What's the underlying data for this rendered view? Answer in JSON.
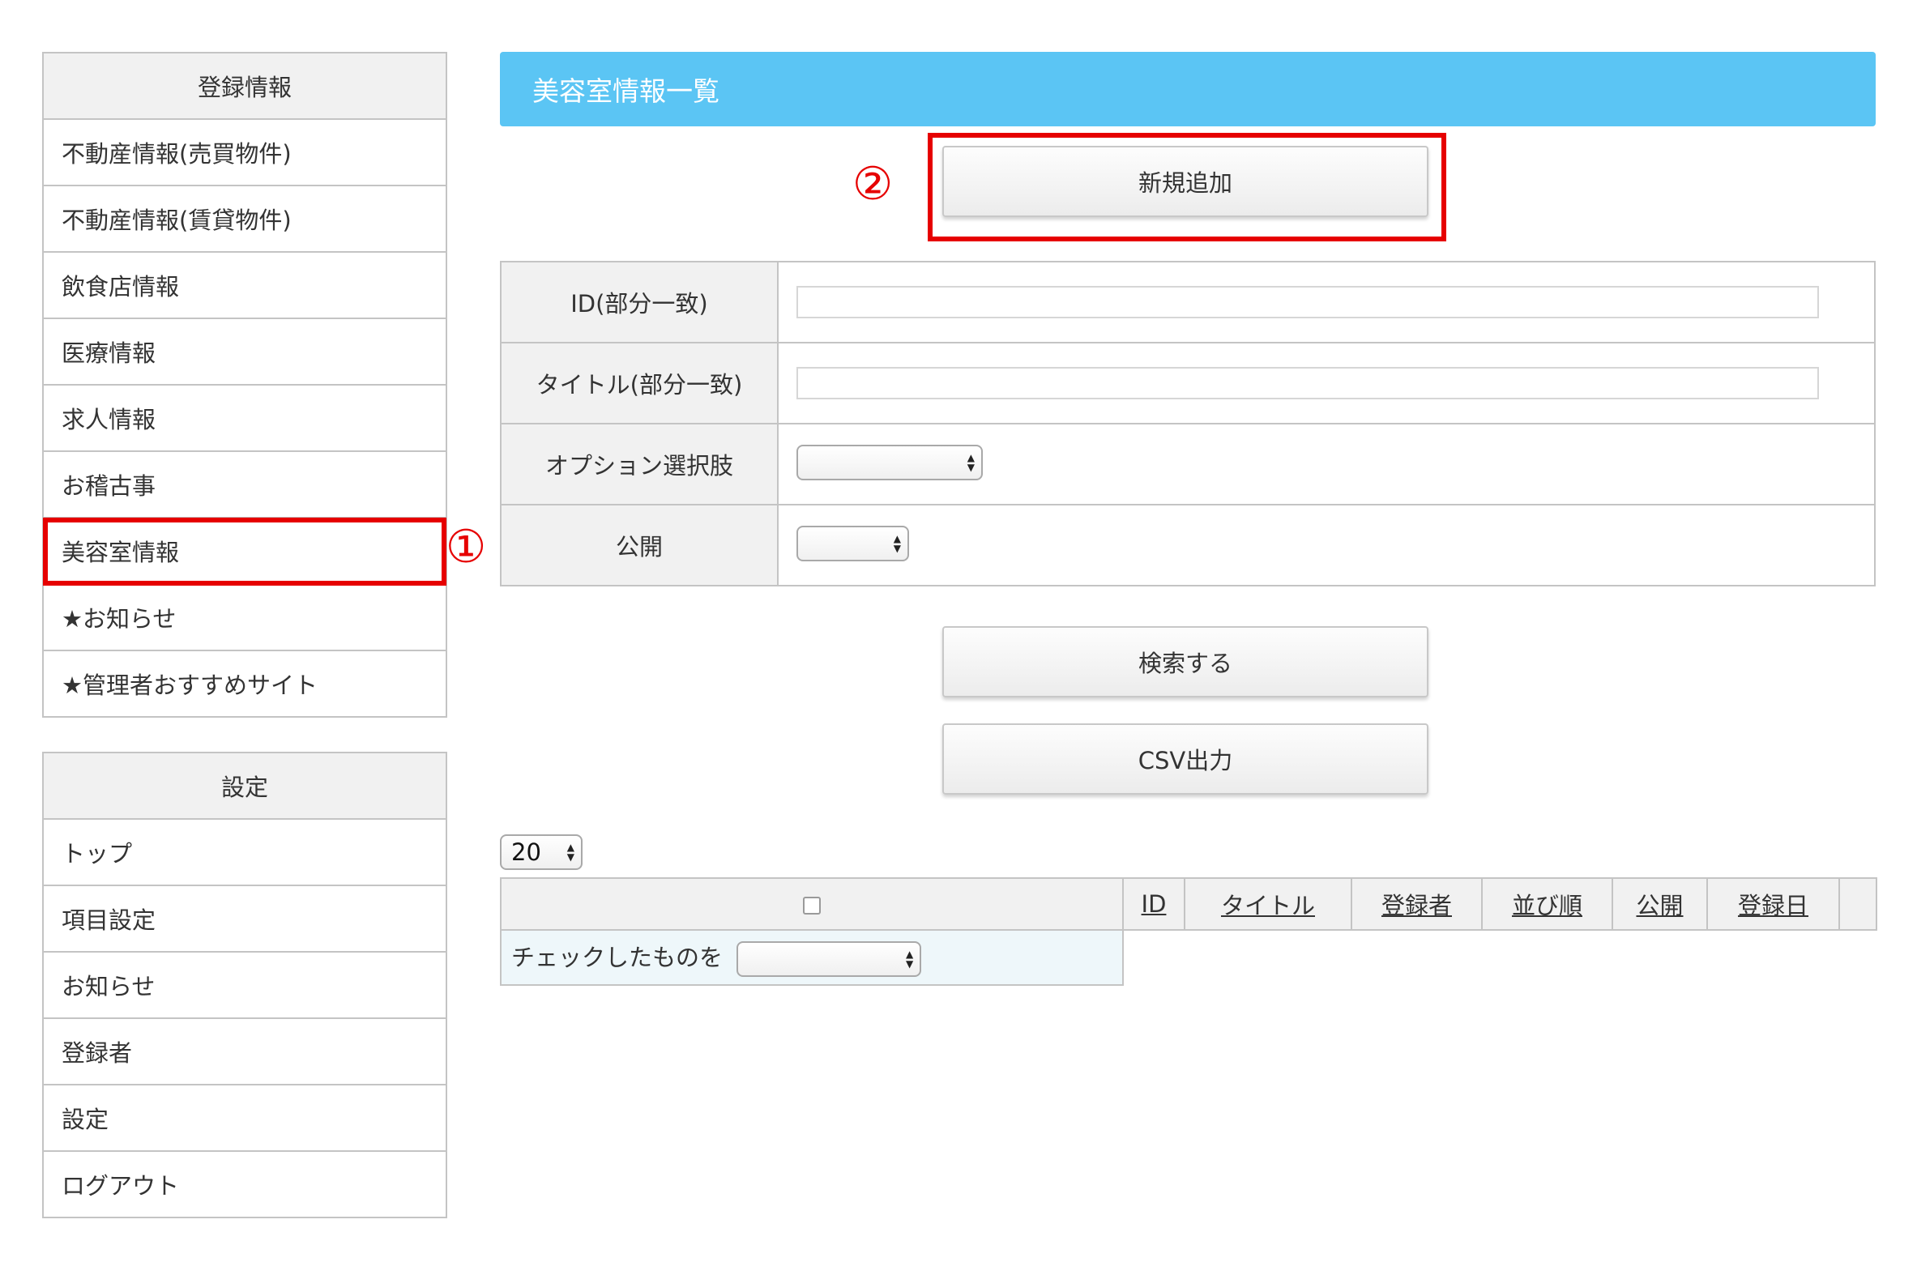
{
  "sidebar": {
    "registration": {
      "heading": "登録情報",
      "items": [
        {
          "label": "不動産情報(売買物件)"
        },
        {
          "label": "不動産情報(賃貸物件)"
        },
        {
          "label": "飲食店情報"
        },
        {
          "label": "医療情報"
        },
        {
          "label": "求人情報"
        },
        {
          "label": "お稽古事"
        },
        {
          "label": "美容室情報"
        },
        {
          "label": "★お知らせ"
        },
        {
          "label": "★管理者おすすめサイト"
        }
      ]
    },
    "settings": {
      "heading": "設定",
      "items": [
        {
          "label": "トップ"
        },
        {
          "label": "項目設定"
        },
        {
          "label": "お知らせ"
        },
        {
          "label": "登録者"
        },
        {
          "label": "設定"
        },
        {
          "label": "ログアウト"
        }
      ]
    }
  },
  "annotations": {
    "one": "①",
    "two": "②"
  },
  "page": {
    "title": "美容室情報一覧",
    "new_button": "新規追加",
    "search_button": "検索する",
    "csv_button": "CSV出力"
  },
  "search": {
    "id_label": "ID(部分一致)",
    "title_label": "タイトル(部分一致)",
    "option_label": "オプション選択肢",
    "public_label": "公開",
    "id_value": "",
    "title_value": "",
    "option_value": "",
    "public_value": ""
  },
  "list": {
    "per_page": "20",
    "columns": [
      "ID",
      "タイトル",
      "登録者",
      "並び順",
      "公開",
      "登録日"
    ],
    "bulk_label": "チェックしたものを",
    "bulk_value": ""
  },
  "colors": {
    "accent": "#5bc5f4",
    "highlight": "#e60000"
  }
}
